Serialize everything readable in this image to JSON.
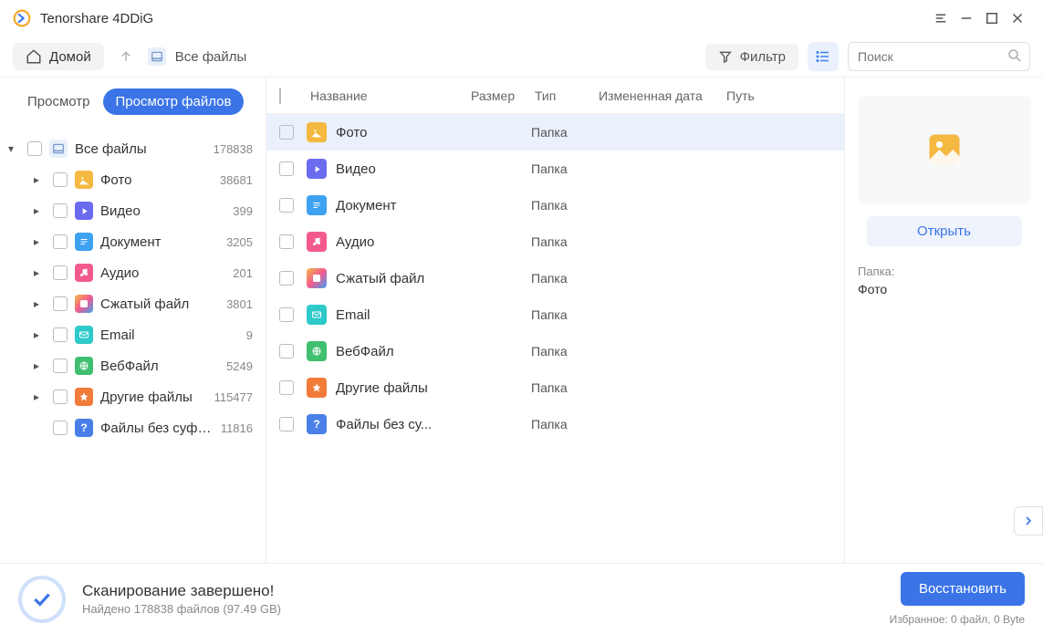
{
  "app": {
    "title": "Tenorshare 4DDiG"
  },
  "toolbar": {
    "home": "Домой",
    "breadcrumb": "Все файлы",
    "filter": "Фильтр",
    "search_placeholder": "Поиск"
  },
  "viewTabs": {
    "tree": "Просмотр",
    "files": "Просмотр файлов"
  },
  "sidebar": {
    "root": {
      "label": "Все файлы",
      "count": "178838"
    },
    "items": [
      {
        "label": "Фото",
        "count": "38681",
        "iconClass": "ico-photo"
      },
      {
        "label": "Видео",
        "count": "399",
        "iconClass": "ico-video"
      },
      {
        "label": "Документ",
        "count": "3205",
        "iconClass": "ico-doc"
      },
      {
        "label": "Аудио",
        "count": "201",
        "iconClass": "ico-audio"
      },
      {
        "label": "Сжатый файл",
        "count": "3801",
        "iconClass": "ico-archive"
      },
      {
        "label": "Email",
        "count": "9",
        "iconClass": "ico-email"
      },
      {
        "label": "ВебФайл",
        "count": "5249",
        "iconClass": "ico-web"
      },
      {
        "label": "Другие файлы",
        "count": "115477",
        "iconClass": "ico-other"
      },
      {
        "label": "Файлы без суффикса",
        "count": "11816",
        "iconClass": "ico-unknown",
        "noExpand": true
      }
    ]
  },
  "columns": {
    "name": "Название",
    "size": "Размер",
    "type": "Тип",
    "date": "Измененная дата",
    "path": "Путь"
  },
  "rows": [
    {
      "name": "Фото",
      "type": "Папка",
      "iconClass": "ico-photo",
      "selected": true
    },
    {
      "name": "Видео",
      "type": "Папка",
      "iconClass": "ico-video"
    },
    {
      "name": "Документ",
      "type": "Папка",
      "iconClass": "ico-doc"
    },
    {
      "name": "Аудио",
      "type": "Папка",
      "iconClass": "ico-audio"
    },
    {
      "name": "Сжатый файл",
      "type": "Папка",
      "iconClass": "ico-archive"
    },
    {
      "name": "Email",
      "type": "Папка",
      "iconClass": "ico-email"
    },
    {
      "name": "ВебФайл",
      "type": "Папка",
      "iconClass": "ico-web"
    },
    {
      "name": "Другие файлы",
      "type": "Папка",
      "iconClass": "ico-other"
    },
    {
      "name": "Файлы без су...",
      "type": "Папка",
      "iconClass": "ico-unknown"
    }
  ],
  "detail": {
    "open": "Открыть",
    "typeLabel": "Папка:",
    "typeValue": "Фото"
  },
  "footer": {
    "title": "Сканирование завершено!",
    "sub": "Найдено 178838 файлов (97.49 GB)",
    "recover": "Восстановить",
    "selected": "Избранное: 0 файл, 0 Byte"
  }
}
